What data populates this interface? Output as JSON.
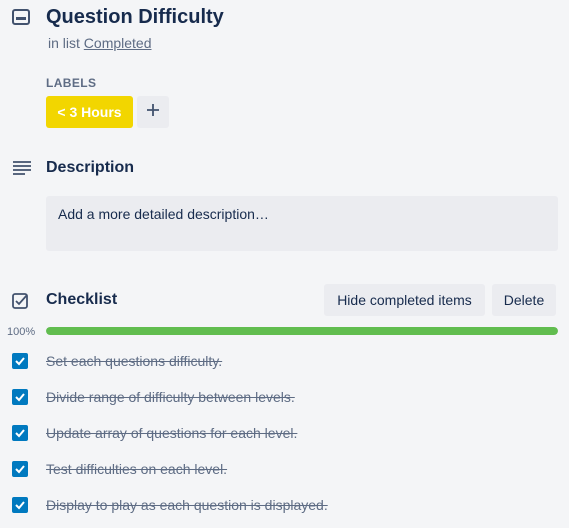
{
  "card": {
    "icon": "card-icon",
    "title": "Question Difficulty",
    "in_list_prefix": "in list",
    "list_name": "Completed"
  },
  "labels": {
    "heading": "LABELS",
    "items": [
      {
        "text": "< 3 Hours",
        "color": "#f2d600"
      }
    ],
    "add_icon": "plus-icon"
  },
  "description": {
    "icon": "description-icon",
    "title": "Description",
    "placeholder": "Add a more detailed description…"
  },
  "checklist": {
    "icon": "checklist-icon",
    "title": "Checklist",
    "hide_completed_label": "Hide completed items",
    "delete_label": "Delete",
    "progress_text": "100%",
    "progress_value": 1.0,
    "progress_color": "#61bd4f",
    "items": [
      {
        "text": "Set each questions difficulty.",
        "checked": true
      },
      {
        "text": "Divide range of difficulty between levels.",
        "checked": true
      },
      {
        "text": "Update array of questions for each level.",
        "checked": true
      },
      {
        "text": "Test difficulties on each level.",
        "checked": true
      },
      {
        "text": "Display to play as each question is displayed.",
        "checked": true
      }
    ]
  }
}
